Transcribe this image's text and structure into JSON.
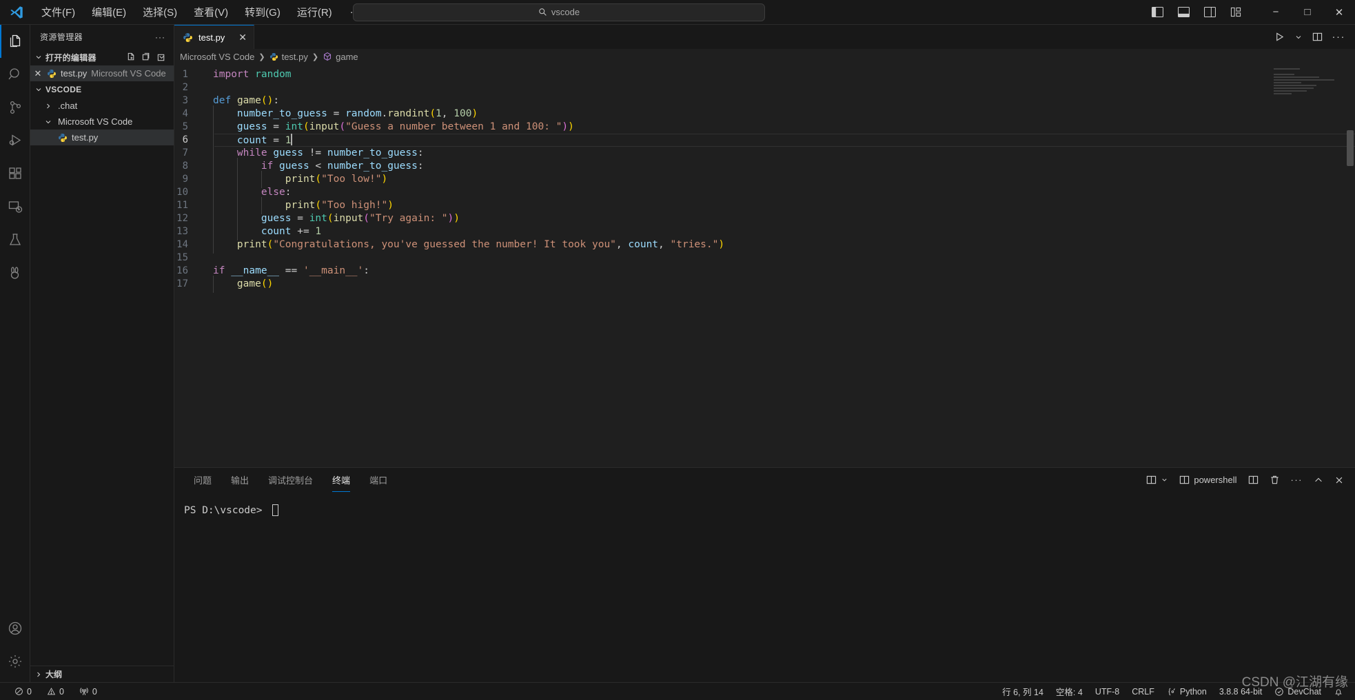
{
  "titlebar": {
    "logo_icon": "vscode-logo-icon",
    "menu": [
      {
        "label": "文件(F)",
        "name": "menu-file"
      },
      {
        "label": "编辑(E)",
        "name": "menu-edit"
      },
      {
        "label": "选择(S)",
        "name": "menu-selection"
      },
      {
        "label": "查看(V)",
        "name": "menu-view"
      },
      {
        "label": "转到(G)",
        "name": "menu-go"
      },
      {
        "label": "运行(R)",
        "name": "menu-run"
      }
    ],
    "more_label": "···",
    "back_icon": "arrow-left-icon",
    "forward_icon": "arrow-right-icon",
    "search": {
      "value": "vscode",
      "icon": "search-icon"
    },
    "layout": {
      "toggle_primary_sidebar": "toggle-primary-sidebar-icon",
      "toggle_panel": "toggle-panel-icon",
      "toggle_secondary_sidebar": "toggle-secondary-sidebar-icon",
      "customize_layout": "customize-layout-icon"
    },
    "window": {
      "minimize": "−",
      "maximize": "□",
      "close": "✕"
    }
  },
  "activitybar": {
    "items": [
      {
        "name": "activity-explorer",
        "icon": "files-icon",
        "active": true
      },
      {
        "name": "activity-search",
        "icon": "search-icon",
        "active": false
      },
      {
        "name": "activity-source-control",
        "icon": "source-control-icon",
        "active": false
      },
      {
        "name": "activity-run-debug",
        "icon": "run-and-debug-icon",
        "active": false
      },
      {
        "name": "activity-extensions",
        "icon": "extensions-icon",
        "active": false
      },
      {
        "name": "activity-remote",
        "icon": "remote-explorer-icon",
        "active": false
      },
      {
        "name": "activity-testing",
        "icon": "beaker-icon",
        "active": false
      },
      {
        "name": "activity-rabbit",
        "icon": "rabbit-icon",
        "active": false
      }
    ],
    "bottom": [
      {
        "name": "activity-accounts",
        "icon": "account-icon"
      },
      {
        "name": "activity-settings",
        "icon": "gear-icon"
      }
    ]
  },
  "sidebar": {
    "title": "资源管理器",
    "more_label": "···",
    "open_editors": {
      "title": "打开的编辑器",
      "actions": [
        "new-file-icon",
        "new-folder-icon",
        "refresh-icon",
        "collapse-all-icon"
      ],
      "items": [
        {
          "close": "✕",
          "icon": "python-file-icon",
          "label": "test.py",
          "sublabel": "Microsoft VS Code",
          "selected": true
        }
      ]
    },
    "workspace": {
      "title": "VSCODE",
      "tree": [
        {
          "label": ".chat",
          "type": "folder",
          "expanded": false,
          "indent": 1
        },
        {
          "label": "Microsoft VS Code",
          "type": "folder",
          "expanded": true,
          "indent": 1
        },
        {
          "label": "test.py",
          "type": "python-file",
          "indent": 2,
          "selected": true
        }
      ]
    },
    "outline": {
      "title": "大纲"
    }
  },
  "editor": {
    "tabs": [
      {
        "label": "test.py",
        "icon": "python-file-icon",
        "active": true,
        "close": "✕"
      }
    ],
    "tab_actions": [
      "run-python-file-icon",
      "chevron-down-icon",
      "split-editor-icon",
      "more-actions-icon"
    ],
    "breadcrumbs": [
      {
        "label": "Microsoft VS Code",
        "icon": ""
      },
      {
        "label": "test.py",
        "icon": "python-file-icon"
      },
      {
        "label": "game",
        "icon": "symbol-method-icon"
      }
    ],
    "breadcrumb_separator": "❯",
    "cursor_line": 6,
    "lines": [
      {
        "n": 1,
        "tokens": [
          {
            "t": "import",
            "c": "k"
          },
          {
            "t": " ",
            "c": "p"
          },
          {
            "t": "random",
            "c": "cls"
          }
        ]
      },
      {
        "n": 2,
        "tokens": []
      },
      {
        "n": 3,
        "tokens": [
          {
            "t": "def",
            "c": "kd"
          },
          {
            "t": " ",
            "c": "p"
          },
          {
            "t": "game",
            "c": "fn"
          },
          {
            "t": "(",
            "c": "y1"
          },
          {
            "t": ")",
            "c": "y1"
          },
          {
            "t": ":",
            "c": "p"
          }
        ]
      },
      {
        "n": 4,
        "indent": 1,
        "tokens": [
          {
            "t": "number_to_guess",
            "c": "v"
          },
          {
            "t": " = ",
            "c": "p"
          },
          {
            "t": "random",
            "c": "v"
          },
          {
            "t": ".",
            "c": "p"
          },
          {
            "t": "randint",
            "c": "fn"
          },
          {
            "t": "(",
            "c": "y1"
          },
          {
            "t": "1",
            "c": "n"
          },
          {
            "t": ", ",
            "c": "p"
          },
          {
            "t": "100",
            "c": "n"
          },
          {
            "t": ")",
            "c": "y1"
          }
        ]
      },
      {
        "n": 5,
        "indent": 1,
        "tokens": [
          {
            "t": "guess",
            "c": "v"
          },
          {
            "t": " = ",
            "c": "p"
          },
          {
            "t": "int",
            "c": "cls"
          },
          {
            "t": "(",
            "c": "y1"
          },
          {
            "t": "input",
            "c": "fn"
          },
          {
            "t": "(",
            "c": "y2"
          },
          {
            "t": "\"Guess a number between 1 and 100: \"",
            "c": "s"
          },
          {
            "t": ")",
            "c": "y2"
          },
          {
            "t": ")",
            "c": "y1"
          }
        ]
      },
      {
        "n": 6,
        "indent": 1,
        "current": true,
        "tokens": [
          {
            "t": "count",
            "c": "v"
          },
          {
            "t": " = ",
            "c": "p"
          },
          {
            "t": "1",
            "c": "n"
          }
        ],
        "cursor": true
      },
      {
        "n": 7,
        "indent": 1,
        "tokens": [
          {
            "t": "while",
            "c": "k"
          },
          {
            "t": " ",
            "c": "p"
          },
          {
            "t": "guess",
            "c": "v"
          },
          {
            "t": " != ",
            "c": "p"
          },
          {
            "t": "number_to_guess",
            "c": "v"
          },
          {
            "t": ":",
            "c": "p"
          }
        ]
      },
      {
        "n": 8,
        "indent": 2,
        "tokens": [
          {
            "t": "if",
            "c": "k"
          },
          {
            "t": " ",
            "c": "p"
          },
          {
            "t": "guess",
            "c": "v"
          },
          {
            "t": " < ",
            "c": "p"
          },
          {
            "t": "number_to_guess",
            "c": "v"
          },
          {
            "t": ":",
            "c": "p"
          }
        ]
      },
      {
        "n": 9,
        "indent": 3,
        "tokens": [
          {
            "t": "print",
            "c": "fn"
          },
          {
            "t": "(",
            "c": "y1"
          },
          {
            "t": "\"Too low!\"",
            "c": "s"
          },
          {
            "t": ")",
            "c": "y1"
          }
        ]
      },
      {
        "n": 10,
        "indent": 2,
        "tokens": [
          {
            "t": "else",
            "c": "k"
          },
          {
            "t": ":",
            "c": "p"
          }
        ]
      },
      {
        "n": 11,
        "indent": 3,
        "tokens": [
          {
            "t": "print",
            "c": "fn"
          },
          {
            "t": "(",
            "c": "y1"
          },
          {
            "t": "\"Too high!\"",
            "c": "s"
          },
          {
            "t": ")",
            "c": "y1"
          }
        ]
      },
      {
        "n": 12,
        "indent": 2,
        "tokens": [
          {
            "t": "guess",
            "c": "v"
          },
          {
            "t": " = ",
            "c": "p"
          },
          {
            "t": "int",
            "c": "cls"
          },
          {
            "t": "(",
            "c": "y1"
          },
          {
            "t": "input",
            "c": "fn"
          },
          {
            "t": "(",
            "c": "y2"
          },
          {
            "t": "\"Try again: \"",
            "c": "s"
          },
          {
            "t": ")",
            "c": "y2"
          },
          {
            "t": ")",
            "c": "y1"
          }
        ]
      },
      {
        "n": 13,
        "indent": 2,
        "tokens": [
          {
            "t": "count",
            "c": "v"
          },
          {
            "t": " += ",
            "c": "p"
          },
          {
            "t": "1",
            "c": "n"
          }
        ]
      },
      {
        "n": 14,
        "indent": 1,
        "tokens": [
          {
            "t": "print",
            "c": "fn"
          },
          {
            "t": "(",
            "c": "y1"
          },
          {
            "t": "\"Congratulations, you've guessed the number! It took you\"",
            "c": "s"
          },
          {
            "t": ", ",
            "c": "p"
          },
          {
            "t": "count",
            "c": "v"
          },
          {
            "t": ", ",
            "c": "p"
          },
          {
            "t": "\"tries.\"",
            "c": "s"
          },
          {
            "t": ")",
            "c": "y1"
          }
        ]
      },
      {
        "n": 15,
        "tokens": []
      },
      {
        "n": 16,
        "tokens": [
          {
            "t": "if",
            "c": "k"
          },
          {
            "t": " ",
            "c": "p"
          },
          {
            "t": "__name__",
            "c": "v"
          },
          {
            "t": " == ",
            "c": "p"
          },
          {
            "t": "'__main__'",
            "c": "s"
          },
          {
            "t": ":",
            "c": "p"
          }
        ]
      },
      {
        "n": 17,
        "indent": 1,
        "tokens": [
          {
            "t": "game",
            "c": "fn"
          },
          {
            "t": "(",
            "c": "y1"
          },
          {
            "t": ")",
            "c": "y1"
          }
        ]
      }
    ]
  },
  "panel": {
    "tabs": [
      {
        "label": "问题",
        "name": "panel-tab-problems",
        "active": false
      },
      {
        "label": "输出",
        "name": "panel-tab-output",
        "active": false
      },
      {
        "label": "调试控制台",
        "name": "panel-tab-debug-console",
        "active": false
      },
      {
        "label": "终端",
        "name": "panel-tab-terminal",
        "active": true
      },
      {
        "label": "端口",
        "name": "panel-tab-ports",
        "active": false
      }
    ],
    "terminal_name": "powershell",
    "actions": [
      "split-terminal-dropdown-icon",
      "new-terminal-icon",
      "split-terminal-icon",
      "kill-terminal-icon",
      "more-actions-icon",
      "maximize-panel-icon",
      "close-panel-icon"
    ],
    "prompt": "PS D:\\vscode>"
  },
  "statusbar": {
    "left": [
      {
        "icon": "error-icon",
        "label": "0",
        "name": "status-errors"
      },
      {
        "icon": "warning-icon",
        "label": "0",
        "name": "status-warnings"
      },
      {
        "icon": "radio-tower-icon",
        "label": "0",
        "name": "status-ports"
      }
    ],
    "right": [
      {
        "label": "行 6, 列 14",
        "name": "status-cursor-position"
      },
      {
        "label": "空格: 4",
        "name": "status-indentation"
      },
      {
        "label": "UTF-8",
        "name": "status-encoding"
      },
      {
        "label": "CRLF",
        "name": "status-eol"
      },
      {
        "label": "Python",
        "name": "status-language-mode",
        "icon": "python-brackets-icon"
      },
      {
        "label": "3.8.8 64-bit",
        "name": "status-python-interpreter"
      },
      {
        "label": "DevChat",
        "name": "status-devchat",
        "icon": "devchat-icon"
      },
      {
        "label": "",
        "name": "status-notifications",
        "icon": "bell-icon"
      }
    ]
  },
  "watermark": "CSDN @江湖有缘"
}
